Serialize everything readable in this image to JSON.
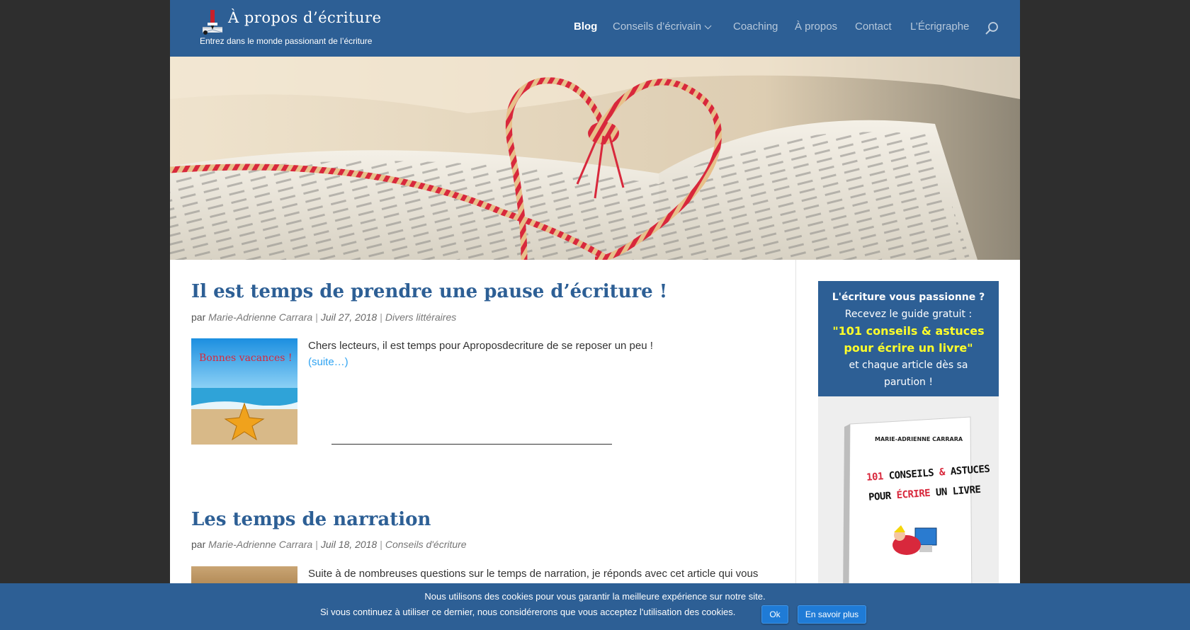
{
  "header": {
    "logo_title": "À propos d’écriture",
    "logo_tagline": "Entrez dans le monde passionant de l’écriture",
    "nav": [
      {
        "label": "Blog",
        "active": true
      },
      {
        "label": "Conseils d’écrivain",
        "has_dropdown": true
      },
      {
        "label": "Coaching"
      },
      {
        "label": "À propos"
      },
      {
        "label": "Contact"
      },
      {
        "label": "L’Écrigraphe"
      }
    ],
    "search_icon": "search-icon"
  },
  "posts": [
    {
      "title": "Il est temps de prendre une pause d’écriture !",
      "meta_prefix": "par",
      "author": "Marie-Adrienne Carrara",
      "date": "Juil 27, 2018",
      "category": "Divers littéraires",
      "thumbnail_caption": "Bonnes vacances !",
      "excerpt": "Chers lecteurs, il est temps pour Aproposdecriture de se reposer un peu !",
      "more": "(suite…)"
    },
    {
      "title": "Les temps de narration",
      "meta_prefix": "par",
      "author": "Marie-Adrienne Carrara",
      "date": "Juil 18, 2018",
      "category": "Conseils d'écriture",
      "excerpt": "Suite à de nombreuses questions sur le temps de narration, je réponds avec cet article qui vous"
    }
  ],
  "sidebar": {
    "headline": "L'écriture vous passionne ?",
    "line2": "Recevez le guide gratuit :",
    "guide_line1": "\"101 conseils & astuces",
    "guide_line2": "pour écrire un livre\"",
    "line4": "et chaque article dès sa",
    "line5": "parution !",
    "book": {
      "author": "MARIE-ADRIENNE CARRARA",
      "title_l1_a": "101",
      "title_l1_b": "CONSEILS",
      "title_l1_c": "&",
      "title_l1_d": "ASTUCES",
      "title_l2_a": "POUR",
      "title_l2_b": "ÉCRIRE",
      "title_l2_c": "UN LIVRE"
    }
  },
  "cookie": {
    "line1": "Nous utilisons des cookies pour vous garantir la meilleure expérience sur notre site.",
    "line2": "Si vous continuez à utiliser ce dernier, nous considérerons que vous acceptez l'utilisation des cookies.",
    "ok": "Ok",
    "more": "En savoir plus"
  },
  "colors": {
    "header_bg": "#2d5f95",
    "title": "#2d5f95",
    "link": "#2ea3f2",
    "page_bg": "#2e2e2e",
    "highlight_yellow": "#ffff2a"
  }
}
